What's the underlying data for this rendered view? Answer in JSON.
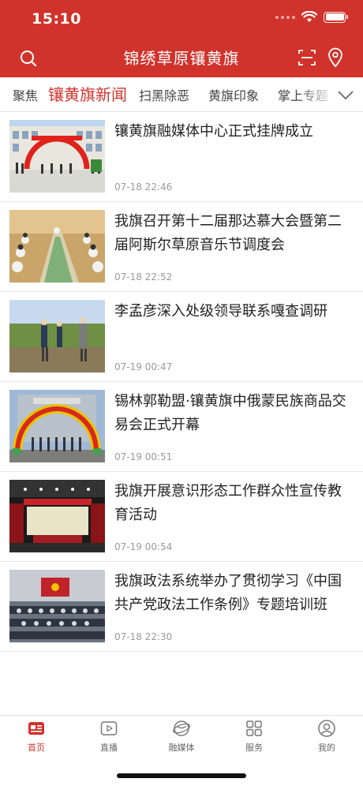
{
  "status_bar": {
    "time": "15:10"
  },
  "colors": {
    "brand_red": "#d0332b",
    "active_tab": "#d0332b",
    "text": "#222222",
    "muted": "#999999"
  },
  "header": {
    "title": "锦绣草原镶黄旗",
    "icons": {
      "left": "search-icon",
      "right": [
        "scan-icon",
        "location-pin-icon"
      ]
    }
  },
  "tabs": [
    {
      "label": "聚焦",
      "active": false
    },
    {
      "label": "镶黄旗新闻",
      "active": true
    },
    {
      "label": "扫黑除恶",
      "active": false
    },
    {
      "label": "黄旗印象",
      "active": false
    },
    {
      "label": "掌上专题",
      "active": false
    }
  ],
  "news": [
    {
      "title": "镶黄旗融媒体中心正式挂牌成立",
      "time": "07-18 22:46"
    },
    {
      "title": "我旗召开第十二届那达慕大会暨第二届阿斯尔草原音乐节调度会",
      "time": "07-18 22:52"
    },
    {
      "title": "李孟彦深入处级领导联系嘎查调研",
      "time": "07-19 00:47"
    },
    {
      "title": "锡林郭勒盟·镶黄旗中俄蒙民族商品交易会正式开幕",
      "time": "07-19 00:51"
    },
    {
      "title": "我旗开展意识形态工作群众性宣传教育活动",
      "time": "07-19 00:54"
    },
    {
      "title": "我旗政法系统举办了贯彻学习《中国共产党政法工作条例》专题培训班",
      "time": "07-18 22:30"
    }
  ],
  "bottom_nav": [
    {
      "label": "首页",
      "icon": "news-home-icon",
      "active": true
    },
    {
      "label": "直播",
      "icon": "play-icon",
      "active": false
    },
    {
      "label": "融媒体",
      "icon": "globe-icon",
      "active": false
    },
    {
      "label": "服务",
      "icon": "grid-icon",
      "active": false
    },
    {
      "label": "我的",
      "icon": "user-icon",
      "active": false
    }
  ]
}
